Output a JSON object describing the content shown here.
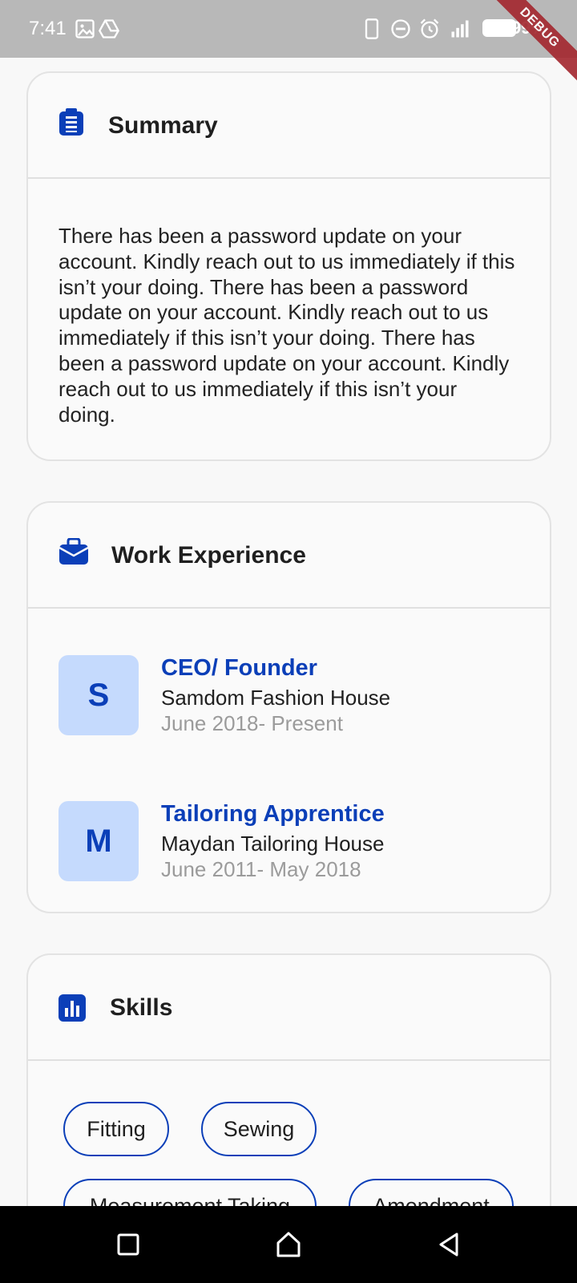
{
  "status_bar": {
    "time": "7:41",
    "battery": "99%",
    "debug_banner": "DEBUG",
    "icons": [
      "image-icon",
      "drive-icon",
      "phone-icon",
      "dnd-icon",
      "alarm-icon",
      "signal-icon",
      "battery-icon"
    ]
  },
  "summary": {
    "title": "Summary",
    "icon": "clipboard-icon",
    "text": "There has been a password update on your account. Kindly reach out to us immediately if this isn’t your doing. There has been a password update on your account. Kindly reach out to us immediately if this isn’t your doing. There has been a password update on your account. Kindly reach out to us immediately if this isn’t your doing."
  },
  "work_experience": {
    "title": "Work Experience",
    "icon": "briefcase-icon",
    "items": [
      {
        "initial": "S",
        "role": "CEO/ Founder",
        "company": "Samdom Fashion House",
        "dates": "June 2018- Present"
      },
      {
        "initial": "M",
        "role": "Tailoring Apprentice",
        "company": "Maydan Tailoring House",
        "dates": "June 2011- May 2018"
      }
    ]
  },
  "skills": {
    "title": "Skills",
    "icon": "bar-chart-icon",
    "chips": [
      "Fitting",
      "Sewing",
      "Measurement Taking",
      "Amendment"
    ]
  },
  "nav_bar": {
    "buttons": [
      "recents-button",
      "home-button",
      "back-button"
    ]
  },
  "colors": {
    "accent": "#0b3fb8",
    "avatar_bg": "#c5dafd",
    "muted_text": "#9b9b9b",
    "status_bar_bg": "#b8b8b8",
    "nav_bar_bg": "#000000"
  }
}
